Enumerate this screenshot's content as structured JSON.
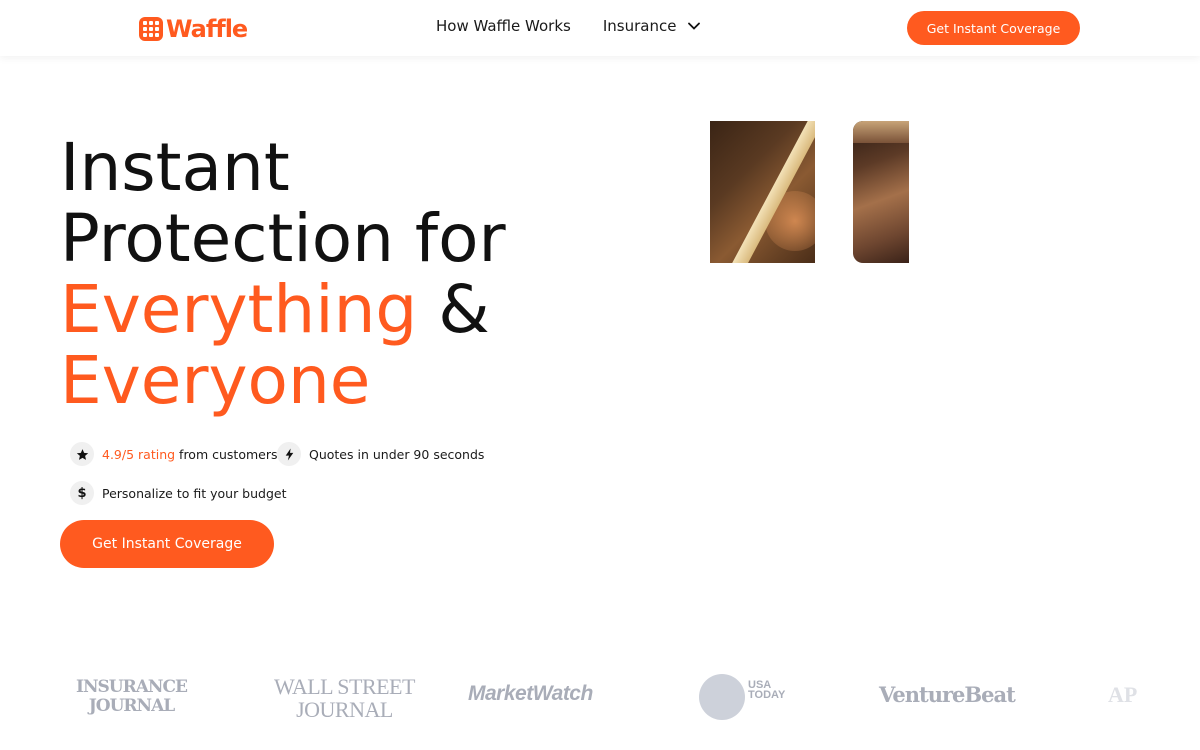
{
  "header": {
    "brand": "Waffle",
    "nav": [
      {
        "label": "How Waffle Works"
      },
      {
        "label": "Insurance"
      }
    ],
    "cta_label": "Get Instant Coverage"
  },
  "hero": {
    "title_line1": "Instant",
    "title_line2": "Protection for",
    "title_line3_accent": "Everything",
    "title_line3_rest": " &",
    "title_line4_accent": "Everyone",
    "features": [
      {
        "highlight": "4.9/5 rating",
        "text": "from customers",
        "icon": "star-icon"
      },
      {
        "text": "Quotes in under 90 seconds",
        "icon": "lightning-icon"
      },
      {
        "text": "Personalize to fit your budget",
        "icon": "dollar-icon"
      }
    ],
    "dollar_glyph": "$",
    "cta_label": "Get Instant Coverage"
  },
  "press": {
    "insurance_journal": [
      "INSURANCE",
      "JOURNAL"
    ],
    "wsj": [
      "WALL STREET",
      "JOURNAL"
    ],
    "marketwatch": "MarketWatch",
    "usa_today": [
      "USA",
      "TODAY"
    ],
    "venturebeat": "VentureBeat",
    "ap": "AP"
  },
  "colors": {
    "accent": "#ff5a1f",
    "press_gray": "#a9adb8"
  }
}
